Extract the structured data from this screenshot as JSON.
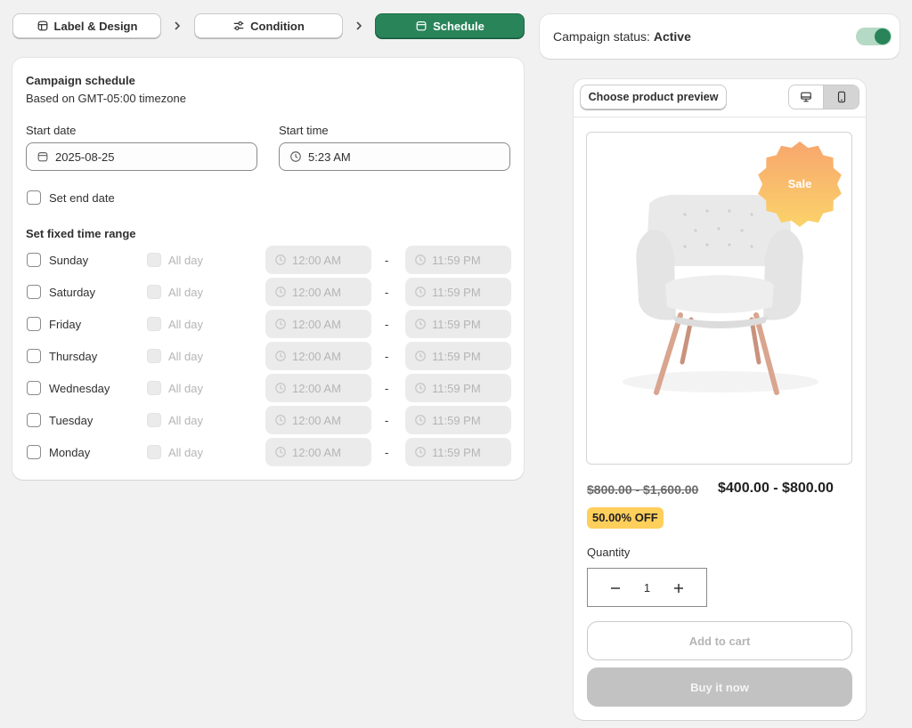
{
  "stepper": {
    "steps": [
      {
        "label": "Label & Design",
        "icon": "label-icon"
      },
      {
        "label": "Condition",
        "icon": "sliders-icon"
      },
      {
        "label": "Schedule",
        "icon": "calendar-icon"
      }
    ],
    "active_color": "#29845a"
  },
  "schedule": {
    "title": "Campaign schedule",
    "timezone": "Based on GMT-05:00 timezone",
    "start_date_label": "Start date",
    "start_date_value": "2025-08-25",
    "start_time_label": "Start time",
    "start_time_value": "5:23 AM",
    "end_date_label": "Set end date",
    "range_title": "Set fixed time range",
    "all_day_label": "All day",
    "separator": "-",
    "days": [
      {
        "name": "Sunday",
        "from": "12:00 AM",
        "to": "11:59 PM"
      },
      {
        "name": "Saturday",
        "from": "12:00 AM",
        "to": "11:59 PM"
      },
      {
        "name": "Friday",
        "from": "12:00 AM",
        "to": "11:59 PM"
      },
      {
        "name": "Thursday",
        "from": "12:00 AM",
        "to": "11:59 PM"
      },
      {
        "name": "Wednesday",
        "from": "12:00 AM",
        "to": "11:59 PM"
      },
      {
        "name": "Tuesday",
        "from": "12:00 AM",
        "to": "11:59 PM"
      },
      {
        "name": "Monday",
        "from": "12:00 AM",
        "to": "11:59 PM"
      }
    ]
  },
  "status": {
    "label": "Campaign status:",
    "value": "Active",
    "toggle_on": true
  },
  "preview": {
    "choose_label": "Choose product preview",
    "badge": "Sale",
    "badge_colors": [
      "#f7a66d",
      "#fbd36a"
    ],
    "compare_price": "$800.00 - $1,600.00",
    "price": "$400.00 - $800.00",
    "discount": "50.00% OFF",
    "discount_color": "#ffcf5c",
    "quantity_label": "Quantity",
    "quantity": "1",
    "add_to_cart": "Add to cart",
    "buy_now": "Buy it now"
  }
}
